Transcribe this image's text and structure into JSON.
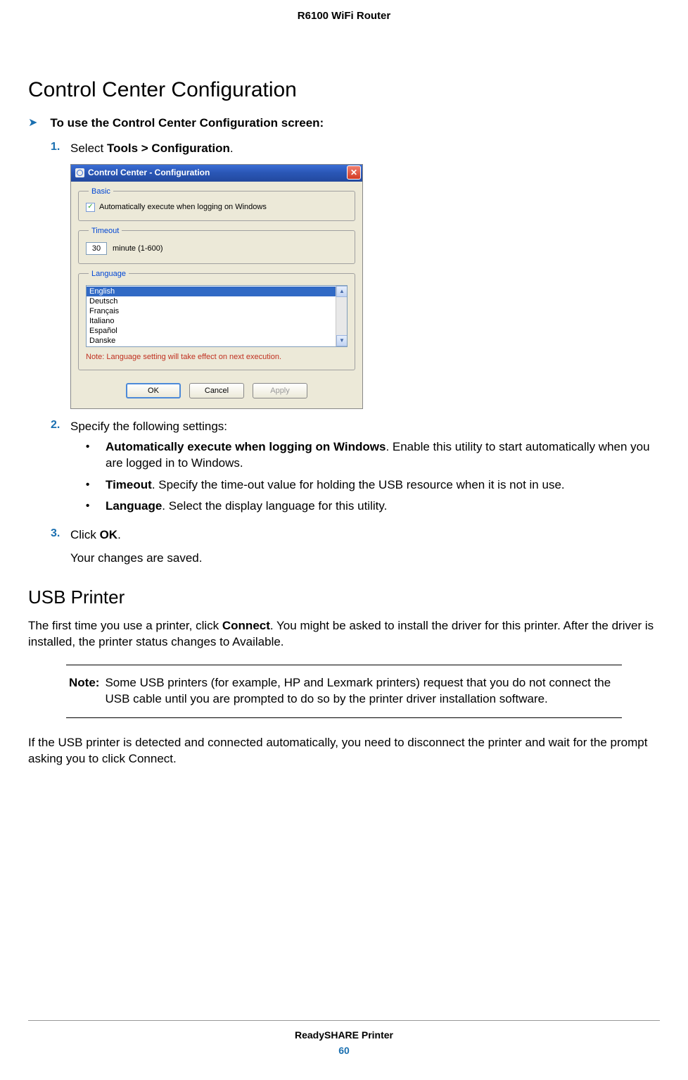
{
  "header": {
    "product": "R6100 WiFi Router"
  },
  "section1": {
    "title": "Control Center Configuration",
    "proc_heading": "To use the Control Center Configuration screen:",
    "step1_prefix": "Select ",
    "step1_bold": "Tools > Configuration",
    "step1_suffix": ".",
    "step2": "Specify the following settings:",
    "bullet_a_bold": "Automatically execute when logging on Windows",
    "bullet_a_rest": ". Enable this utility to start automatically when you are logged in to Windows.",
    "bullet_b_bold": "Timeout",
    "bullet_b_rest": ". Specify the time-out value for holding the USB resource when it is not in use.",
    "bullet_c_bold": "Language",
    "bullet_c_rest": ". Select the display language for this utility.",
    "step3_prefix": "Click ",
    "step3_bold": "OK",
    "step3_suffix": ".",
    "step3_result": "Your changes are saved."
  },
  "dialog": {
    "title": "Control Center - Configuration",
    "group_basic": "Basic",
    "chk_label": "Automatically execute when logging on Windows",
    "chk_checked": true,
    "group_timeout": "Timeout",
    "timeout_value": "30",
    "timeout_unit": "minute (1-600)",
    "group_language": "Language",
    "languages": [
      "English",
      "Deutsch",
      "Français",
      "Italiano",
      "Español",
      "Danske"
    ],
    "lang_selected_index": 0,
    "lang_note": "Note: Language setting will take effect on next execution.",
    "btn_ok": "OK",
    "btn_cancel": "Cancel",
    "btn_apply": "Apply"
  },
  "section2": {
    "title": "USB Printer",
    "para1_a": "The first time you use a printer, click ",
    "para1_bold": "Connect",
    "para1_b": ". You might be asked to install the driver for this printer. After the driver is installed, the printer status changes to Available.",
    "note_label": "Note:",
    "note_text": "Some USB printers (for example, HP and Lexmark printers) request that you do not connect the USB cable until you are prompted to do so by the printer driver installation software.",
    "para2": "If the USB printer is detected and connected automatically, you need to disconnect the printer and wait for the prompt asking you to click Connect."
  },
  "footer": {
    "title": "ReadySHARE Printer",
    "page": "60"
  }
}
